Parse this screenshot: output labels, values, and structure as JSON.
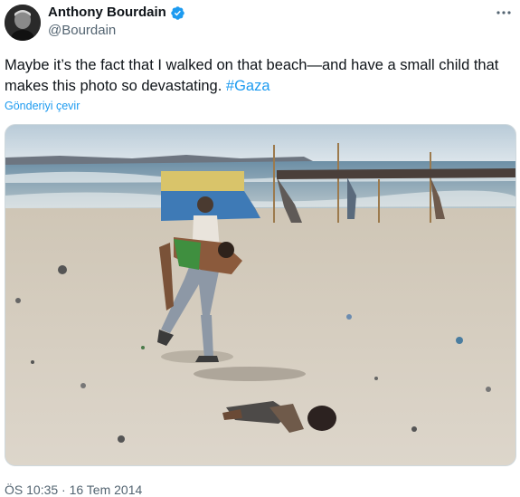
{
  "author": {
    "display_name": "Anthony Bourdain",
    "handle": "@Bourdain",
    "verified": true,
    "avatar_icon": "avatar-portrait"
  },
  "tweet": {
    "text_before": "Maybe it’s the fact that I walked on that beach—and have a small child that makes this photo so devastating. ",
    "hashtag": "#Gaza",
    "translate_label": "Gönderiyi çevir",
    "timestamp": "ÖS 10:35 · 16 Tem 2014"
  },
  "menu": {
    "more_icon": "more-horizontal-icon"
  },
  "colors": {
    "accent": "#1d9bf0",
    "secondary_text": "#536471",
    "border": "#cfd9de"
  }
}
